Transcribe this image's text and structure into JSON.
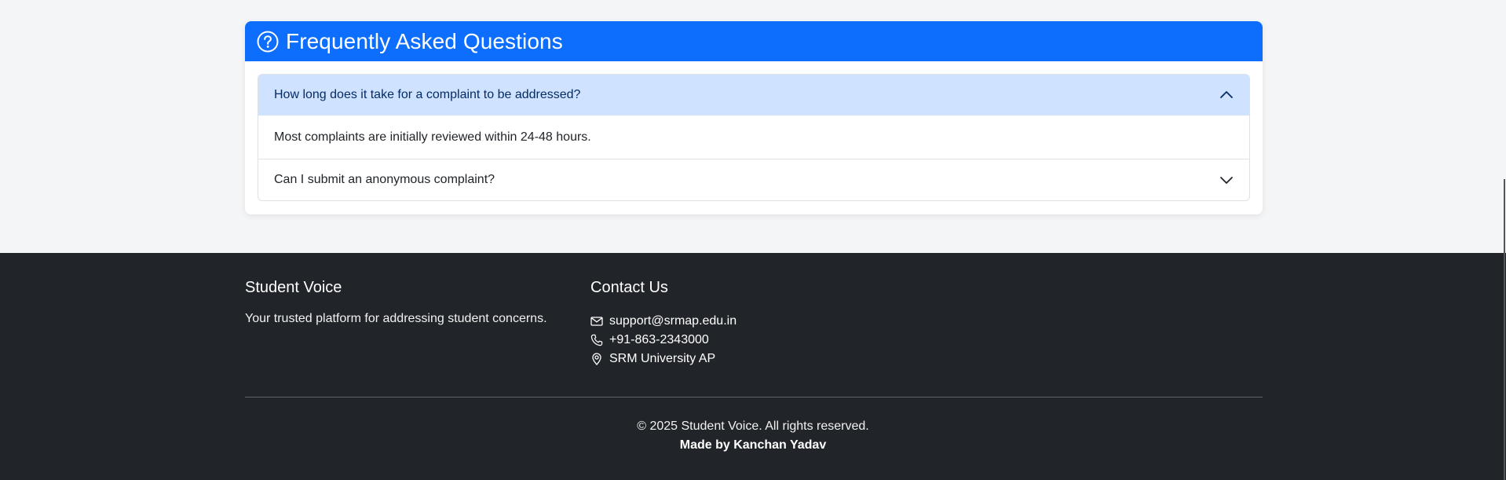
{
  "faq": {
    "title": "Frequently Asked Questions",
    "icon": "question-circle-icon",
    "items": [
      {
        "question": "How long does it take for a complaint to be addressed?",
        "answer": "Most complaints are initially reviewed within 24-48 hours.",
        "expanded": true
      },
      {
        "question": "Can I submit an anonymous complaint?",
        "expanded": false
      }
    ]
  },
  "footer": {
    "brand": {
      "title": "Student Voice",
      "tagline": "Your trusted platform for addressing student concerns."
    },
    "contact": {
      "title": "Contact Us",
      "email": "support@srmap.edu.in",
      "phone": "+91-863-2343000",
      "location": "SRM University AP"
    },
    "copyright": "© 2025 Student Voice. All rights reserved.",
    "made_by": "Made by Kanchan Yadav"
  },
  "colors": {
    "primary": "#0d6efd",
    "accordion_open_bg": "#cfe2ff",
    "footer_bg": "#212529",
    "page_bg": "#f4f5f7"
  }
}
